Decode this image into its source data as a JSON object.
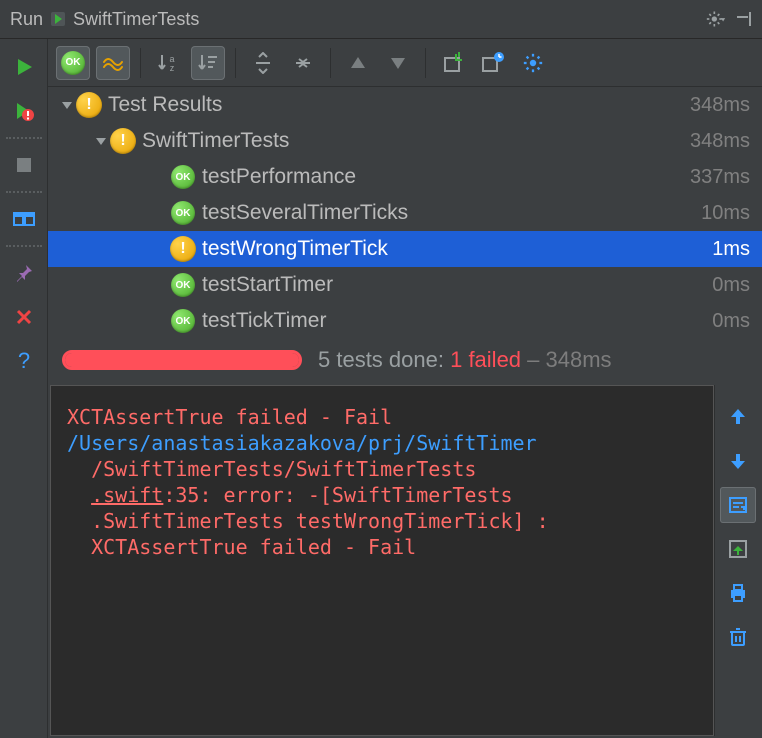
{
  "titlebar": {
    "run_label": "Run",
    "config_name": "SwiftTimerTests"
  },
  "tree": {
    "root": {
      "name": "Test Results",
      "duration": "348ms",
      "status": "warn"
    },
    "suite": {
      "name": "SwiftTimerTests",
      "duration": "348ms",
      "status": "warn"
    },
    "tests": [
      {
        "name": "testPerformance",
        "duration": "337ms",
        "status": "ok",
        "selected": false
      },
      {
        "name": "testSeveralTimerTicks",
        "duration": "10ms",
        "status": "ok",
        "selected": false
      },
      {
        "name": "testWrongTimerTick",
        "duration": "1ms",
        "status": "warn",
        "selected": true
      },
      {
        "name": "testStartTimer",
        "duration": "0ms",
        "status": "ok",
        "selected": false
      },
      {
        "name": "testTickTimer",
        "duration": "0ms",
        "status": "ok",
        "selected": false
      }
    ]
  },
  "summary": {
    "done_prefix": "5 tests done: ",
    "fail_text": "1 failed",
    "time_suffix": " – 348ms"
  },
  "console": {
    "line1": "XCTAssertTrue failed - Fail",
    "link": "/Users/anastasiakazakova/prj/SwiftTimer",
    "line3": "  /SwiftTimerTests/SwiftTimerTests",
    "line4a": "  ",
    "line4b": ".swift",
    "line4c": ":35: error: -[SwiftTimerTests",
    "line5": "  .SwiftTimerTests testWrongTimerTick] :",
    "line6": "  XCTAssertTrue failed - Fail"
  },
  "badges": {
    "ok_text": "OK",
    "warn_text": "!"
  },
  "colors": {
    "accent_run": "#3cb33c",
    "fail": "#ff4f59",
    "selection": "#1e5fd6",
    "link": "#3d9eff"
  }
}
